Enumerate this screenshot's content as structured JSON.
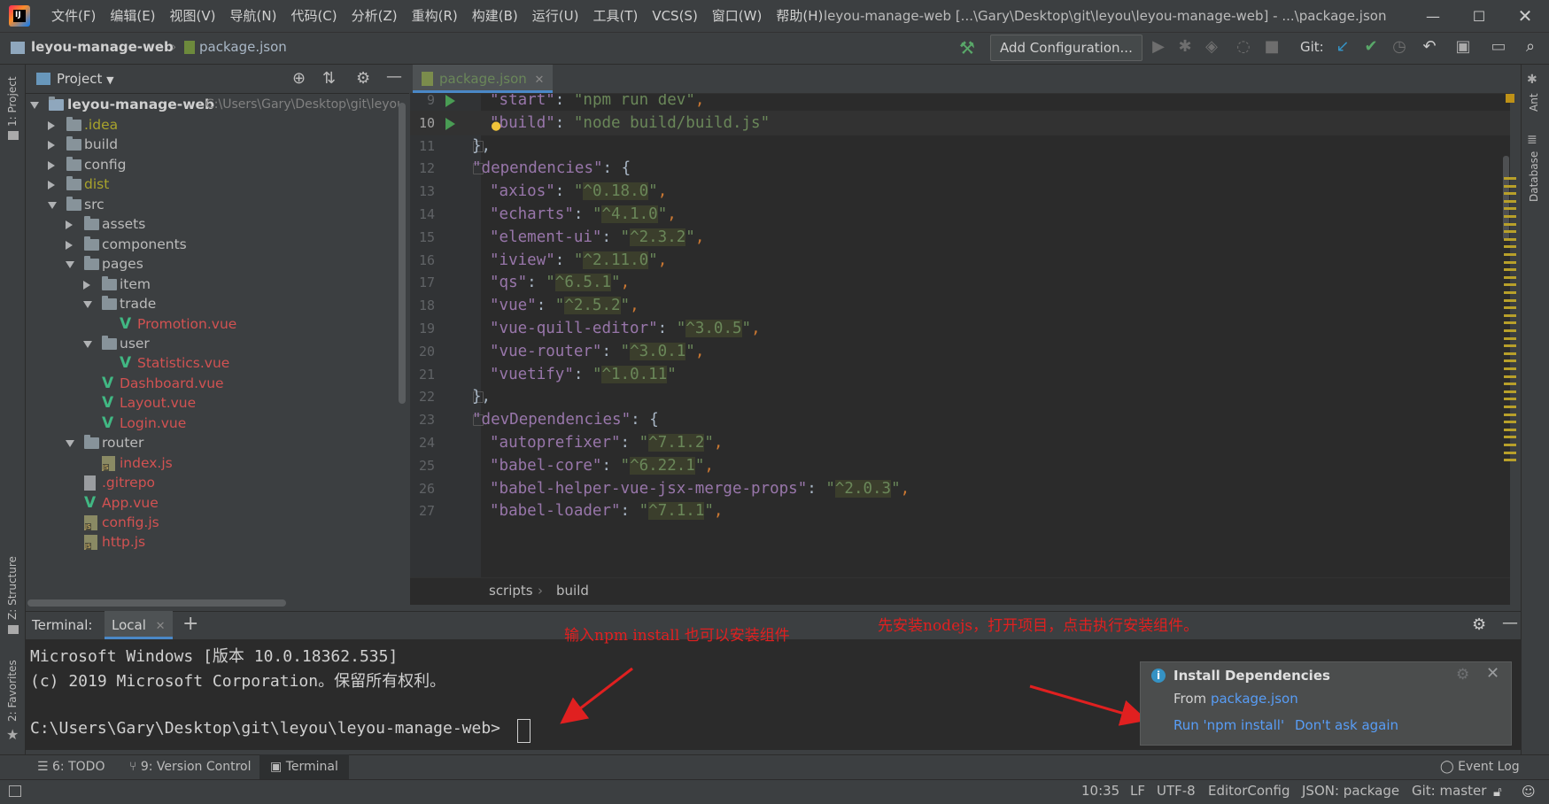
{
  "menubar": [
    "文件(F)",
    "编辑(E)",
    "视图(V)",
    "导航(N)",
    "代码(C)",
    "分析(Z)",
    "重构(R)",
    "构建(B)",
    "运行(U)",
    "工具(T)",
    "VCS(S)",
    "窗口(W)",
    "帮助(H)"
  ],
  "window_title": "leyou-manage-web [...\\Gary\\Desktop\\git\\leyou\\leyou-manage-web] - ...\\package.json",
  "navbar": {
    "project": "leyou-manage-web",
    "file": "package.json",
    "add_config": "Add Configuration...",
    "git_label": "Git:"
  },
  "left_strip": {
    "project": "1: Project",
    "structure": "Z: Structure",
    "favorites": "2: Favorites"
  },
  "right_strip": {
    "ant": "Ant",
    "database": "Database"
  },
  "project_panel": {
    "header": "Project",
    "root": {
      "name": "leyou-manage-web",
      "path": "C:\\Users\\Gary\\Desktop\\git\\leyou"
    },
    "items": [
      {
        "label": ".idea",
        "kind": "folder",
        "state": "closed",
        "color": "olive"
      },
      {
        "label": "build",
        "kind": "folder",
        "state": "closed",
        "color": "default"
      },
      {
        "label": "config",
        "kind": "folder",
        "state": "closed",
        "color": "default"
      },
      {
        "label": "dist",
        "kind": "folder",
        "state": "closed",
        "color": "olive"
      },
      {
        "label": "src",
        "kind": "folder",
        "state": "open",
        "color": "default"
      },
      {
        "label": "assets",
        "kind": "folder",
        "state": "closed",
        "color": "default"
      },
      {
        "label": "components",
        "kind": "folder",
        "state": "closed",
        "color": "default"
      },
      {
        "label": "pages",
        "kind": "folder",
        "state": "open",
        "color": "default"
      },
      {
        "label": "item",
        "kind": "folder",
        "state": "closed",
        "color": "default"
      },
      {
        "label": "trade",
        "kind": "folder",
        "state": "open",
        "color": "default"
      },
      {
        "label": "Promotion.vue",
        "kind": "vue",
        "color": "red"
      },
      {
        "label": "user",
        "kind": "folder",
        "state": "open",
        "color": "default"
      },
      {
        "label": "Statistics.vue",
        "kind": "vue",
        "color": "red"
      },
      {
        "label": "Dashboard.vue",
        "kind": "vue",
        "color": "red"
      },
      {
        "label": "Layout.vue",
        "kind": "vue",
        "color": "red"
      },
      {
        "label": "Login.vue",
        "kind": "vue",
        "color": "red"
      },
      {
        "label": "router",
        "kind": "folder",
        "state": "open",
        "color": "default"
      },
      {
        "label": "index.js",
        "kind": "js",
        "color": "red"
      },
      {
        "label": ".gitrepo",
        "kind": "file",
        "color": "red"
      },
      {
        "label": "App.vue",
        "kind": "vue",
        "color": "red"
      },
      {
        "label": "config.js",
        "kind": "js",
        "color": "red"
      },
      {
        "label": "http.js",
        "kind": "js",
        "color": "red"
      }
    ]
  },
  "editor": {
    "tab": "package.json",
    "lines": [
      {
        "n": "9",
        "indent": 2,
        "key": "start",
        "value": "npm run dev",
        "trail": ",",
        "run": true
      },
      {
        "n": "10",
        "indent": 2,
        "key": "build",
        "value": "node build/build.js",
        "trail": "",
        "run": true,
        "current": true
      },
      {
        "n": "11",
        "indent": 1,
        "raw": "},"
      },
      {
        "n": "12",
        "indent": 1,
        "key": "dependencies",
        "open": true
      },
      {
        "n": "13",
        "indent": 2,
        "key": "axios",
        "value": "^0.18.0",
        "trail": ",",
        "hl": true
      },
      {
        "n": "14",
        "indent": 2,
        "key": "echarts",
        "value": "^4.1.0",
        "trail": ",",
        "hl": true
      },
      {
        "n": "15",
        "indent": 2,
        "key": "element-ui",
        "value": "^2.3.2",
        "trail": ",",
        "hl": true
      },
      {
        "n": "16",
        "indent": 2,
        "key": "iview",
        "value": "^2.11.0",
        "trail": ",",
        "hl": true
      },
      {
        "n": "17",
        "indent": 2,
        "key": "qs",
        "value": "^6.5.1",
        "trail": ",",
        "hl": true
      },
      {
        "n": "18",
        "indent": 2,
        "key": "vue",
        "value": "^2.5.2",
        "trail": ",",
        "hl": true
      },
      {
        "n": "19",
        "indent": 2,
        "key": "vue-quill-editor",
        "value": "^3.0.5",
        "trail": ",",
        "hl": true
      },
      {
        "n": "20",
        "indent": 2,
        "key": "vue-router",
        "value": "^3.0.1",
        "trail": ",",
        "hl": true
      },
      {
        "n": "21",
        "indent": 2,
        "key": "vuetify",
        "value": "^1.0.11",
        "trail": "",
        "hl": true
      },
      {
        "n": "22",
        "indent": 1,
        "raw": "},"
      },
      {
        "n": "23",
        "indent": 1,
        "key": "devDependencies",
        "open": true
      },
      {
        "n": "24",
        "indent": 2,
        "key": "autoprefixer",
        "value": "^7.1.2",
        "trail": ",",
        "hl": true
      },
      {
        "n": "25",
        "indent": 2,
        "key": "babel-core",
        "value": "^6.22.1",
        "trail": ",",
        "hl": true
      },
      {
        "n": "26",
        "indent": 2,
        "key": "babel-helper-vue-jsx-merge-props",
        "value": "^2.0.3",
        "trail": ",",
        "hl": true
      },
      {
        "n": "27",
        "indent": 2,
        "key": "babel-loader",
        "value": "^7.1.1",
        "trail": ",",
        "hl": true
      }
    ],
    "breadcrumb": [
      "scripts",
      "build"
    ]
  },
  "terminal": {
    "label": "Terminal:",
    "tab": "Local",
    "lines": [
      "Microsoft Windows [版本 10.0.18362.535]",
      "(c) 2019 Microsoft Corporation。保留所有权利。",
      "",
      "C:\\Users\\Gary\\Desktop\\git\\leyou\\leyou-manage-web>"
    ],
    "annotation_left": "输入npm install 也可以安装组件",
    "annotation_right": "先安装nodejs，打开项目，点击执行安装组件。"
  },
  "popup": {
    "title": "Install Dependencies",
    "from_prefix": "From",
    "from_link": "package.json",
    "action_run": "Run 'npm install'",
    "action_dismiss": "Don't ask again"
  },
  "tool_windows": {
    "todo": "6: TODO",
    "vcs": "9: Version Control",
    "terminal": "Terminal",
    "event_log": "Event Log"
  },
  "status": {
    "position": "10:35",
    "line_sep": "LF",
    "encoding": "UTF-8",
    "editorconfig": "EditorConfig",
    "schema": "JSON: package",
    "git": "Git: master"
  }
}
